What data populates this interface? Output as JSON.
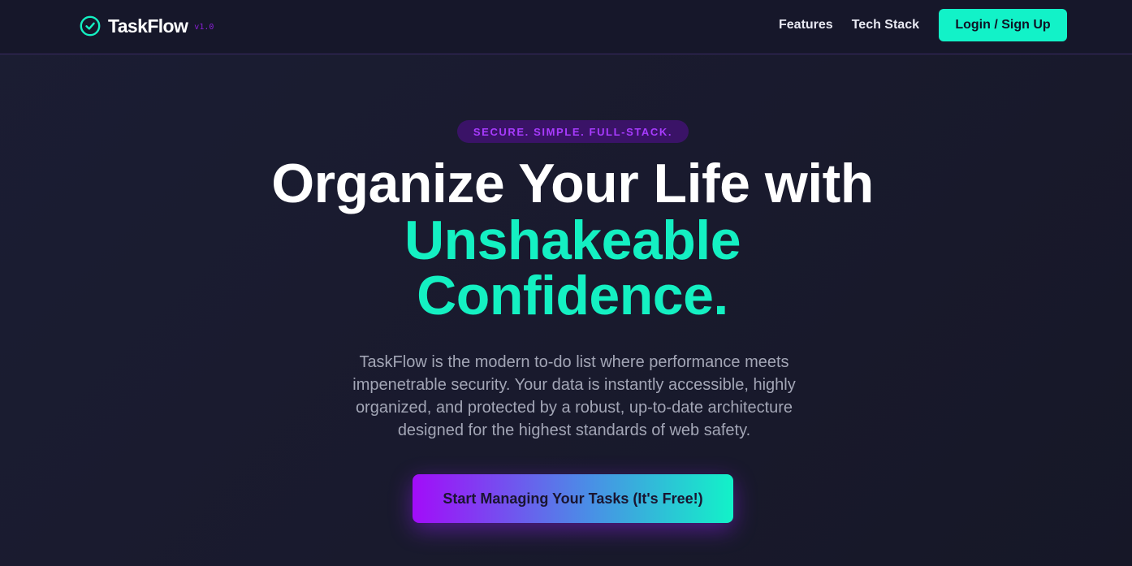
{
  "header": {
    "brand_name": "TaskFlow",
    "brand_version": "v1.0",
    "brand_icon": "check-circle-icon",
    "nav_features": "Features",
    "nav_tech_stack": "Tech Stack",
    "login_label": "Login / Sign Up"
  },
  "hero": {
    "badge": "SECURE. SIMPLE. FULL-STACK.",
    "headline_line1": "Organize Your Life with",
    "headline_line2": "Unshakeable",
    "headline_line3": "Confidence.",
    "description": "TaskFlow is the modern to-do list where performance meets impenetrable security. Your data is instantly accessible, highly organized, and protected by a robust, up-to-date architecture designed for the highest standards of web safety.",
    "cta_label": "Start Managing Your Tasks (It's Free!)"
  },
  "colors": {
    "accent": "#14f0c2",
    "purple": "#a20cf9",
    "background": "#181a2e"
  }
}
